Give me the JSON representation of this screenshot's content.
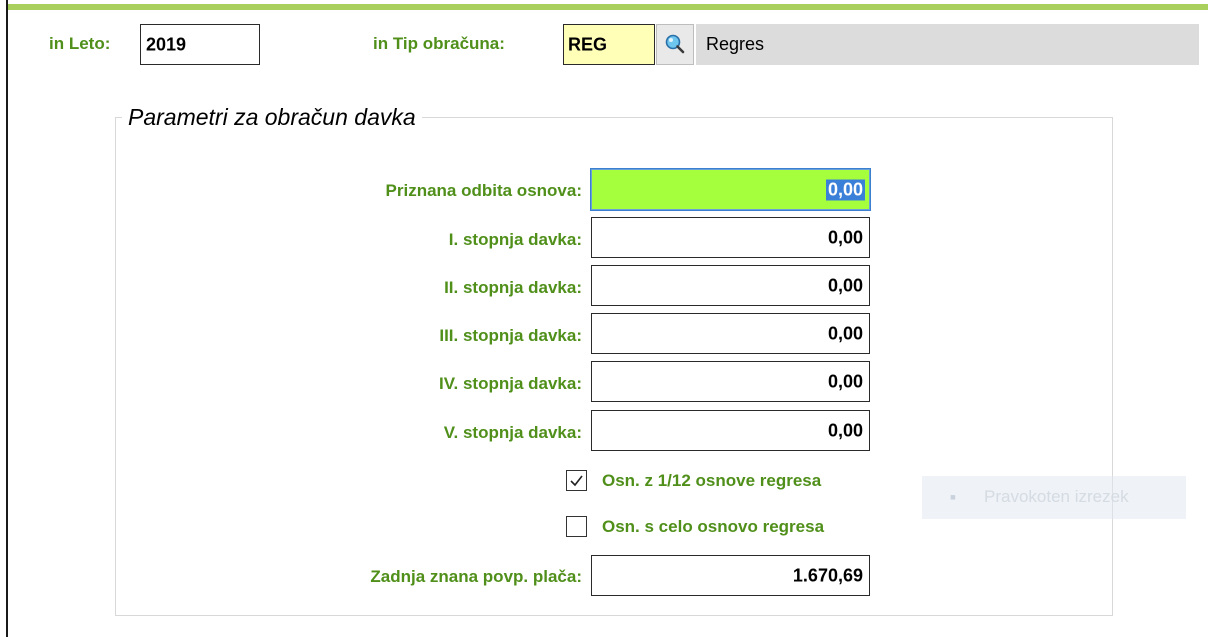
{
  "header": {
    "leto_label": "in Leto:",
    "leto_value": "2019",
    "tip_label": "in Tip obračuna:",
    "tip_value": "REG",
    "tip_description": "Regres",
    "lookup_icon": "search-lookup-icon"
  },
  "group": {
    "title": "Parametri za obračun davka"
  },
  "params": [
    {
      "label": "Priznana odbita osnova:",
      "value": "0,00"
    },
    {
      "label": "I. stopnja davka:",
      "value": "0,00"
    },
    {
      "label": "II. stopnja davka:",
      "value": "0,00"
    },
    {
      "label": "III. stopnja davka:",
      "value": "0,00"
    },
    {
      "label": "IV. stopnja davka:",
      "value": "0,00"
    },
    {
      "label": "V. stopnja davka:",
      "value": "0,00"
    }
  ],
  "checkboxes": [
    {
      "label": "Osn. z 1/12 osnove regresa",
      "checked": true
    },
    {
      "label": "Osn. s celo osnovo regresa",
      "checked": false
    }
  ],
  "last_salary": {
    "label": "Zadnja znana povp. plača:",
    "value": "1.670,69"
  },
  "overlay": {
    "text": "Pravokoten izrezek",
    "icon": "snip-icon"
  },
  "colors": {
    "label_green": "#4f8f1a",
    "active_field": "#a6ff3c",
    "code_field": "#ffffb8",
    "top_bar": "#a9cf5d"
  }
}
